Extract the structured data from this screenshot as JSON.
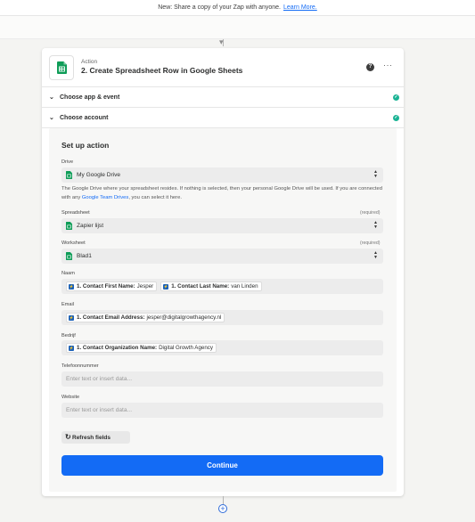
{
  "banner": {
    "text": "New: Share a copy of your Zap with anyone.",
    "link": "Learn More."
  },
  "step": {
    "kind": "Action",
    "title": "2. Create Spreadsheet Row in Google Sheets",
    "app_icon": "google-sheets-icon"
  },
  "sections": [
    {
      "label": "Choose app & event",
      "status": "complete"
    },
    {
      "label": "Choose account",
      "status": "complete"
    }
  ],
  "setup": {
    "title": "Set up action",
    "drive": {
      "label": "Drive",
      "value": "My Google Drive",
      "help_before": "The Google Drive where your spreadsheet resides. If nothing is selected, then your personal Google Drive will be used. If you are connected with any ",
      "help_link": "Google Team Drives",
      "help_after": ", you can select it here."
    },
    "spreadsheet": {
      "label": "Spreadsheet",
      "required": "(required)",
      "value": "Zapier lijst"
    },
    "worksheet": {
      "label": "Worksheet",
      "required": "(required)",
      "value": "Blad1"
    },
    "naam": {
      "label": "Naam",
      "tokens": [
        {
          "key": "1. Contact First Name:",
          "value": "Jesper"
        },
        {
          "key": "1. Contact Last Name:",
          "value": "van Linden"
        }
      ]
    },
    "email": {
      "label": "Email",
      "tokens": [
        {
          "key": "1. Contact Email Address:",
          "value": "jesper@digitalgrowthagency.nl"
        }
      ]
    },
    "bedrijf": {
      "label": "Bedrijf",
      "tokens": [
        {
          "key": "1. Contact Organization Name:",
          "value": "Digital Growth Agency"
        }
      ]
    },
    "telefoon": {
      "label": "Telefoonnummer",
      "placeholder": "Enter text or insert data..."
    },
    "website": {
      "label": "Website",
      "placeholder": "Enter text or insert data..."
    },
    "refresh_label": "Refresh fields",
    "continue_label": "Continue"
  },
  "colors": {
    "accent": "#136bf5",
    "success": "#1ab394",
    "sheets_green": "#0f9d58",
    "token_blue": "#1c62b9"
  }
}
